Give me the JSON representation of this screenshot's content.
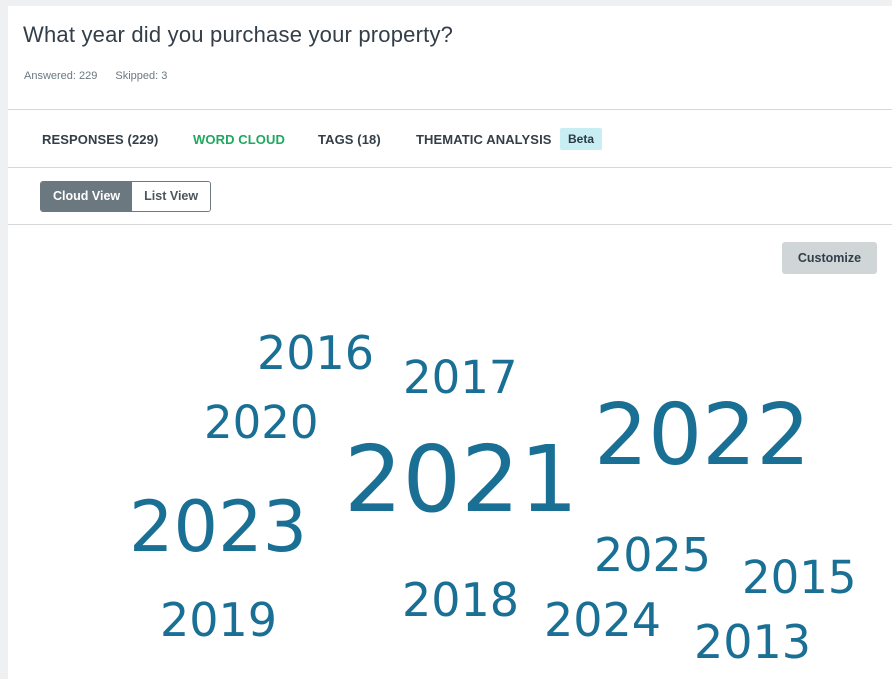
{
  "question": {
    "title": "What year did you purchase your property?",
    "answered_label": "Answered: 229",
    "skipped_label": "Skipped: 3"
  },
  "tabs": [
    {
      "label": "RESPONSES (229)",
      "active": false
    },
    {
      "label": "WORD CLOUD",
      "active": true
    },
    {
      "label": "TAGS (18)",
      "active": false
    },
    {
      "label": "THEMATIC ANALYSIS",
      "active": false
    }
  ],
  "beta_badge": "Beta",
  "view_toggle": {
    "cloud_view": "Cloud View",
    "list_view": "List View",
    "selected": "Cloud View"
  },
  "customize_label": "Customize",
  "word_cloud": [
    {
      "word": "2016"
    },
    {
      "word": "2017"
    },
    {
      "word": "2020"
    },
    {
      "word": "2022"
    },
    {
      "word": "2021"
    },
    {
      "word": "2023"
    },
    {
      "word": "2025"
    },
    {
      "word": "2015"
    },
    {
      "word": "2018"
    },
    {
      "word": "2019"
    },
    {
      "word": "2024"
    },
    {
      "word": "2013"
    }
  ],
  "colors": {
    "word_color": "#1a6f95",
    "active_tab": "#1fa85f",
    "beta_bg": "#c8eef4",
    "toggle_selected": "#6b787f"
  }
}
